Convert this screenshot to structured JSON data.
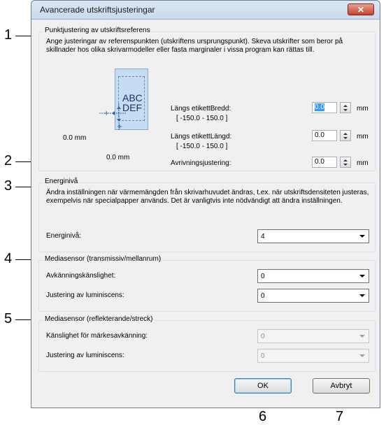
{
  "dialog": {
    "title": "Avancerade utskriftsjusteringar",
    "close_icon": "close-icon"
  },
  "callouts": [
    "1",
    "2",
    "3",
    "4",
    "5",
    "6",
    "7"
  ],
  "print_ref": {
    "group_label": "Punktjustering av utskriftsreferens",
    "description": "Ange justeringar av referenspunkten (utskriftens ursprungspunkt). Skeva utskrifter som beror på skillnader hos olika skrivarmodeller eller fasta marginaler i vissa program kan rättas till.",
    "preview_text_line1": "ABC",
    "preview_text_line2": "DEF",
    "preview_x_label": "0.0 mm",
    "preview_y_label": "0.0 mm",
    "width_label": "Längs etikettBredd:",
    "width_range": "[ -150.0 - 150.0 ]",
    "width_value": "0.0",
    "length_label": "Längs etikettLängd:",
    "length_range": "[ -150.0 - 150.0 ]",
    "length_value": "0.0",
    "tear_label": "Avrivningsjustering:",
    "tear_value": "0.0",
    "unit": "mm"
  },
  "energy": {
    "group_label": "Energinivå",
    "description": "Ändra inställningen när värmemängden från skrivarhuvudet ändras, t.ex. när utskriftsdensiteten justeras, exempelvis när specialpapper används. Det är vanligtvis inte nödvändigt att ändra inställningen.",
    "field_label": "Energinivå:",
    "value": "4"
  },
  "media_trans": {
    "group_label": "Mediasensor (transmissiv/mellanrum)",
    "sensitivity_label": "Avkänningskänslighet:",
    "sensitivity_value": "0",
    "luminance_label": "Justering av luminiscens:",
    "luminance_value": "0"
  },
  "media_refl": {
    "group_label": "Mediasensor (reflekterande/streck)",
    "sensitivity_label": "Känslighet för märkesavkänning:",
    "sensitivity_value": "0",
    "luminance_label": "Justering av luminiscens:",
    "luminance_value": "0"
  },
  "buttons": {
    "ok": "OK",
    "cancel": "Avbryt"
  }
}
